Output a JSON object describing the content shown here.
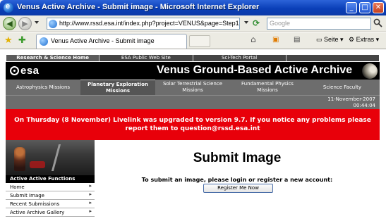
{
  "window": {
    "title": "Venus Active Archive - Submit image - Microsoft Internet Explorer",
    "minimize": "_",
    "maximize": "□",
    "close": "✕"
  },
  "browser": {
    "url": "http://www.rssd.esa.int/index.php?project=VENUS&page=Step1",
    "search_placeholder": "Google",
    "tab_title": "Venus Active Archive - Submit image",
    "page_menu": "Seite",
    "tools_menu": "Extras",
    "icons": [
      "back-icon",
      "forward-icon",
      "refresh-icon",
      "stop-icon",
      "search-icon",
      "favorites-star-icon",
      "add-favorites-icon",
      "home-icon",
      "feeds-icon",
      "print-icon"
    ]
  },
  "page": {
    "top_nav": [
      "Research & Science Home",
      "ESA Public Web Site",
      "Sci-Tech Portal",
      ""
    ],
    "brand": "esa",
    "banner_title": "Venus Ground-Based Active Archive",
    "category_nav": [
      "Astrophysics Missions",
      "Planetary Exploration Missions",
      "Solar Terrestrial Science Missions",
      "Fundamental Physics Missions",
      "Science Faculty"
    ],
    "date": "11-November-2007",
    "time": "00:44:04",
    "alert": "On Thursday (8 November) Livelink was upgraded to version 9.7. If you notice any problems please report them to question@rssd.esa.int",
    "sidebar": {
      "header": "Active Active Functions",
      "items": [
        "Home",
        "Submit Image",
        "Recent Submissions",
        "Active Archive Gallery"
      ]
    },
    "main": {
      "title": "Submit Image",
      "instruction": "To submit an image, please login or register a new account:",
      "register_button": "Register Me Now"
    }
  }
}
